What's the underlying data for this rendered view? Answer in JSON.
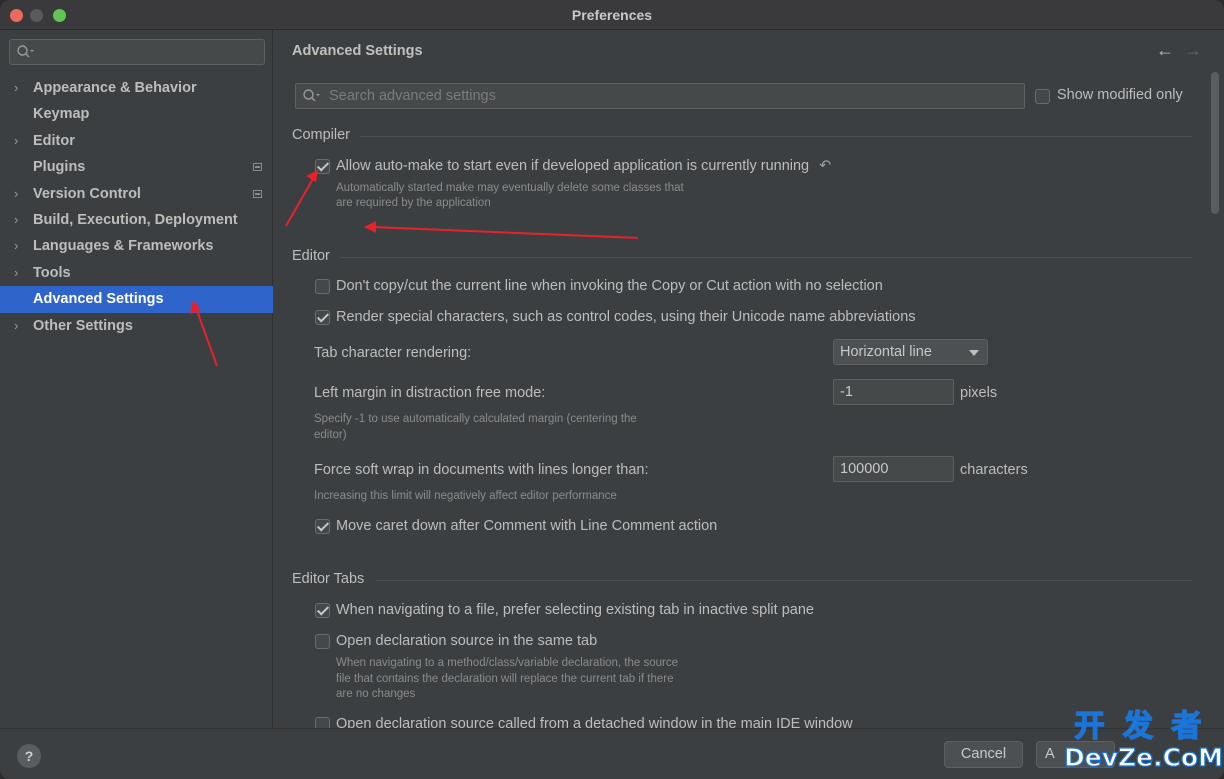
{
  "window": {
    "title": "Preferences"
  },
  "sidebar": {
    "search_placeholder": "",
    "items": [
      {
        "label": "Appearance & Behavior",
        "expandable": true,
        "modified": false
      },
      {
        "label": "Keymap",
        "expandable": false,
        "modified": false
      },
      {
        "label": "Editor",
        "expandable": true,
        "modified": false
      },
      {
        "label": "Plugins",
        "expandable": false,
        "modified": true
      },
      {
        "label": "Version Control",
        "expandable": true,
        "modified": true
      },
      {
        "label": "Build, Execution, Deployment",
        "expandable": true,
        "modified": false
      },
      {
        "label": "Languages & Frameworks",
        "expandable": true,
        "modified": false
      },
      {
        "label": "Tools",
        "expandable": true,
        "modified": false
      },
      {
        "label": "Advanced Settings",
        "expandable": false,
        "modified": false,
        "selected": true
      },
      {
        "label": "Other Settings",
        "expandable": true,
        "modified": false
      }
    ]
  },
  "main": {
    "title": "Advanced Settings",
    "search_placeholder": "Search advanced settings",
    "show_modified_label": "Show modified only",
    "sections": {
      "compiler": {
        "title": "Compiler",
        "automake_label": "Allow auto-make to start even if developed application is currently running",
        "automake_checked": true,
        "automake_hint_1": "Automatically started make may eventually delete some classes that",
        "automake_hint_2": "are required by the application"
      },
      "editor": {
        "title": "Editor",
        "copy_cut_label": "Don't copy/cut the current line when invoking the Copy or Cut action with no selection",
        "copy_cut_checked": false,
        "render_special_label": "Render special characters, such as control codes, using their Unicode name abbreviations",
        "render_special_checked": true,
        "tab_rendering_label": "Tab character rendering:",
        "tab_rendering_value": "Horizontal line",
        "left_margin_label": "Left margin in distraction free mode:",
        "left_margin_value": "-1",
        "left_margin_unit": "pixels",
        "left_margin_hint_1": "Specify -1 to use automatically calculated margin (centering the",
        "left_margin_hint_2": "editor)",
        "soft_wrap_label": "Force soft wrap in documents with lines longer than:",
        "soft_wrap_value": "100000",
        "soft_wrap_unit": "characters",
        "soft_wrap_hint": "Increasing this limit will negatively affect editor performance",
        "move_caret_label": "Move caret down after Comment with Line Comment action",
        "move_caret_checked": true
      },
      "editor_tabs": {
        "title": "Editor Tabs",
        "prefer_existing_label": "When navigating to a file, prefer selecting existing tab in inactive split pane",
        "prefer_existing_checked": true,
        "open_same_tab_label": "Open declaration source in the same tab",
        "open_same_tab_checked": false,
        "open_same_tab_hint_1": "When navigating to a method/class/variable declaration, the source",
        "open_same_tab_hint_2": "file that contains the declaration will replace the current tab if there",
        "open_same_tab_hint_3": "are no changes",
        "open_detached_label": "Open declaration source called from a detached window in the main IDE window",
        "open_detached_checked": false
      }
    }
  },
  "footer": {
    "help_label": "?",
    "cancel_label": "Cancel",
    "apply_label": "A"
  },
  "watermark": {
    "line1": "开 发 者",
    "line2": "DevZe.CoM"
  },
  "colors": {
    "selection": "#2f65ca",
    "annotation_arrow": "#e8212b",
    "background": "#3c3f41"
  }
}
